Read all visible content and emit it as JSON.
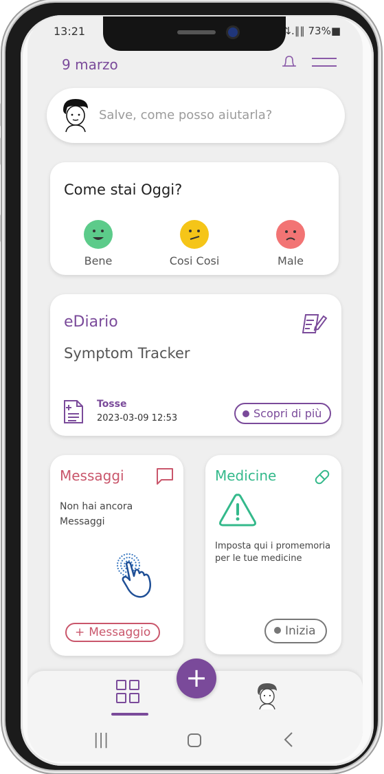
{
  "status": {
    "time": "13:21",
    "signal": "⇅.∥∥ 73%■"
  },
  "header": {
    "date": "9 marzo"
  },
  "assistant": {
    "placeholder": "Salve, come posso aiutarla?"
  },
  "mood": {
    "title": "Come stai Oggi?",
    "options": [
      {
        "label": "Bene",
        "color": "#5ccb8a"
      },
      {
        "label": "Cosi Cosi",
        "color": "#f5c518"
      },
      {
        "label": "Male",
        "color": "#f27474"
      }
    ]
  },
  "diary": {
    "title": "eDiario",
    "subtitle": "Symptom Tracker",
    "entry_name": "Tosse",
    "entry_date": "2023-03-09 12:53",
    "more_label": "Scopri di più"
  },
  "messages": {
    "title": "Messaggi",
    "empty_text": "Non hai ancora Messaggi",
    "button_label": "Messaggio"
  },
  "medicine": {
    "title": "Medicine",
    "text": "Imposta qui i promemoria per le tue medicine",
    "button_label": "Inizia"
  },
  "colors": {
    "primary": "#7a4a9a",
    "messages": "#c9566b",
    "medicine": "#34b98b"
  },
  "nav": {
    "icons": [
      "dashboard-icon",
      "add-icon",
      "profile-icon"
    ]
  }
}
